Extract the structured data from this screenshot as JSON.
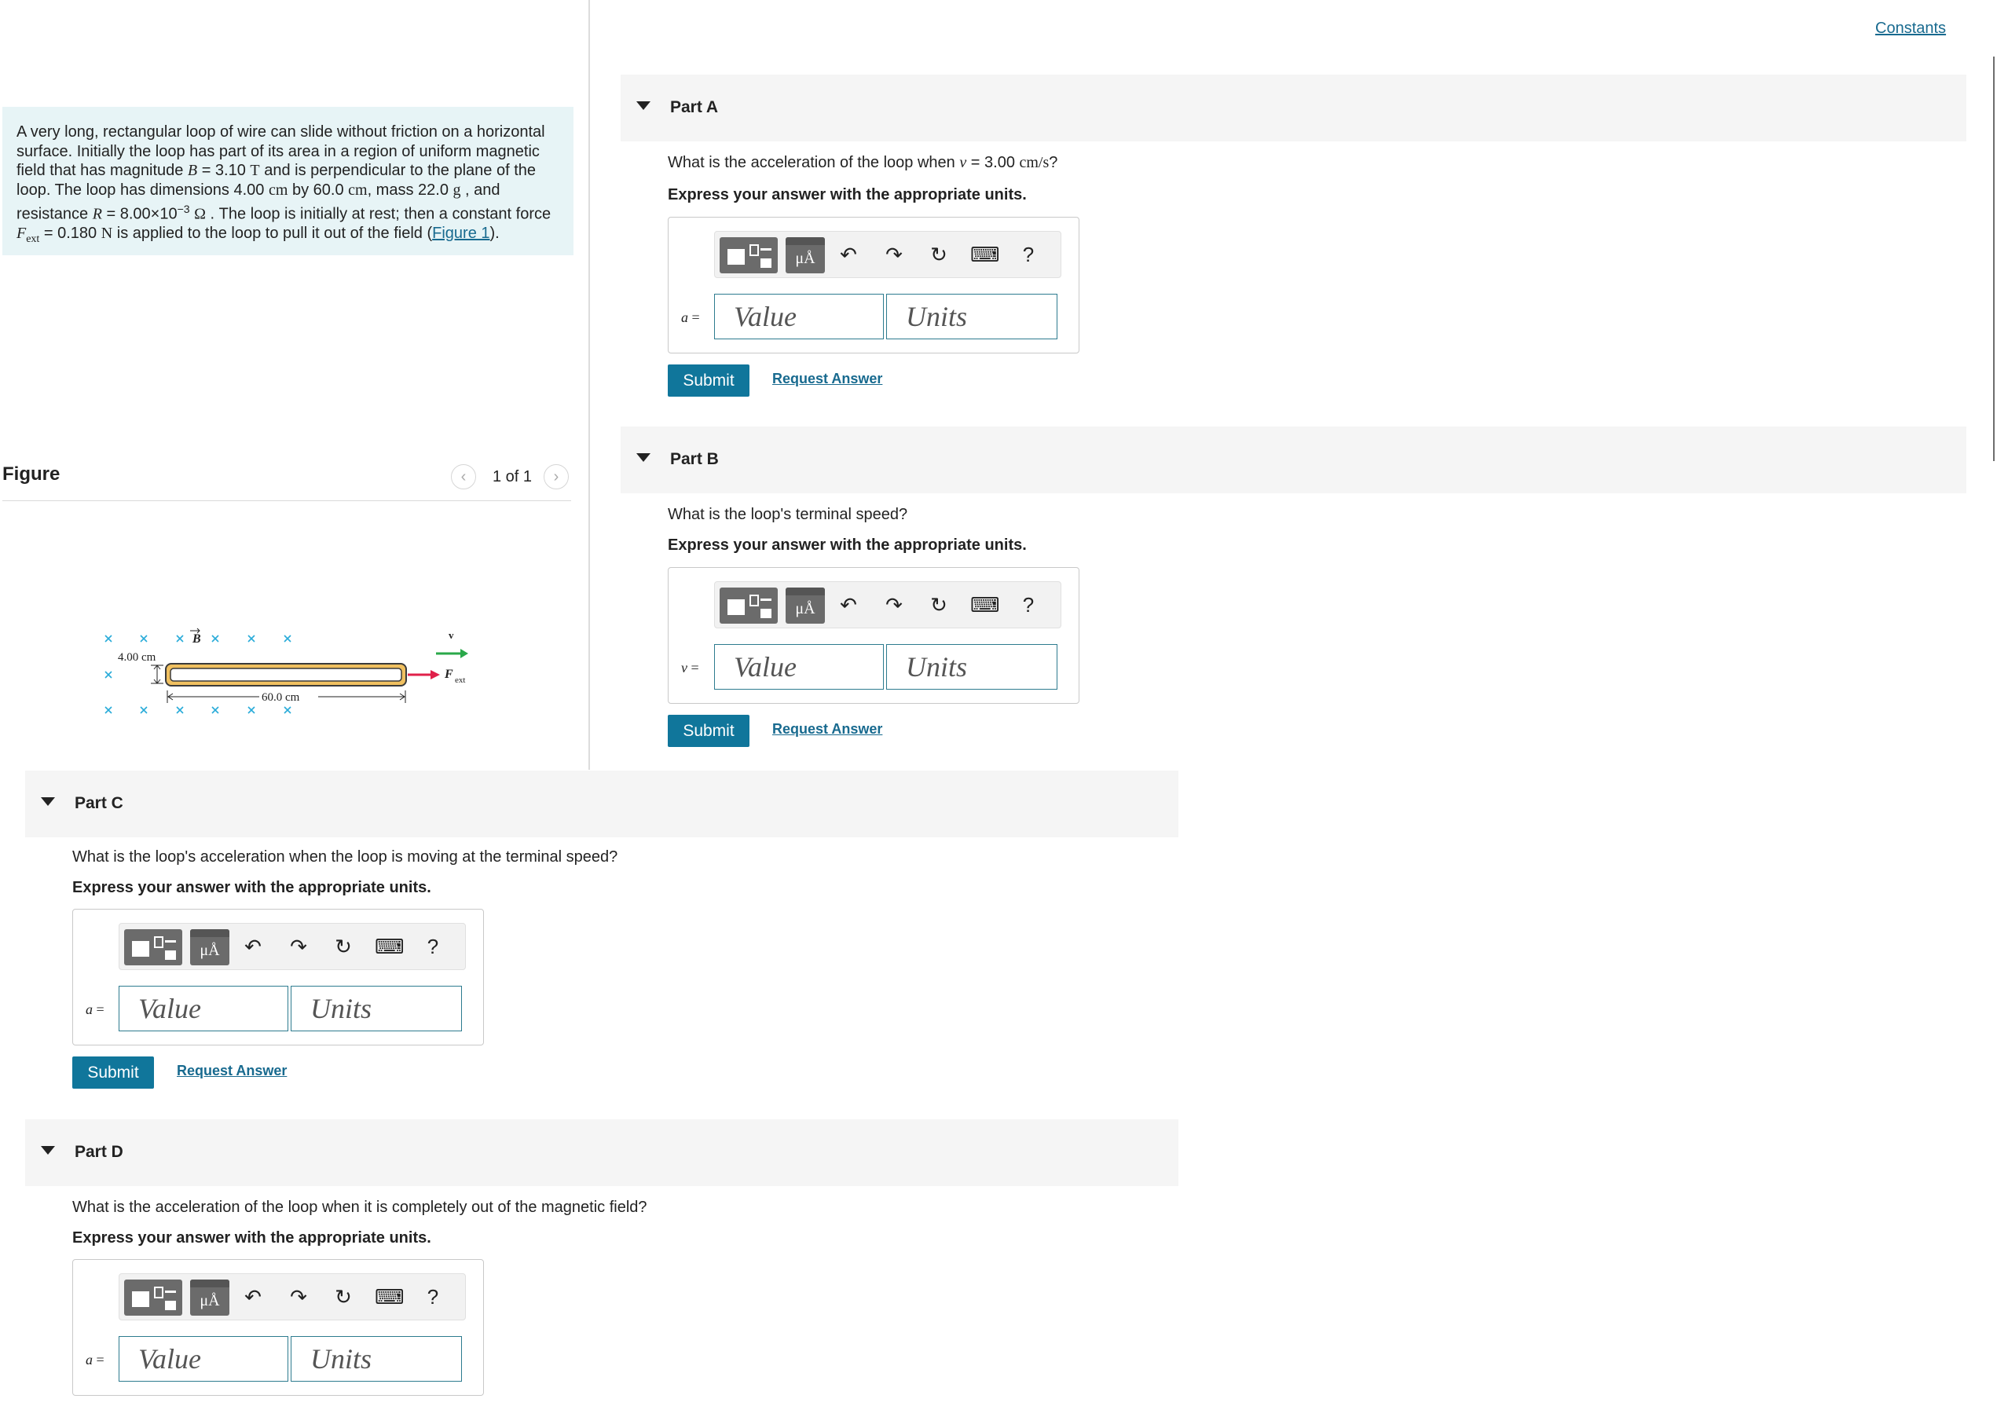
{
  "header": {
    "constants_link": "Constants"
  },
  "problem": {
    "text_1": "A very long, rectangular loop of wire can slide without friction on a horizontal surface. Initially the loop has part of its area in a region of uniform magnetic field that has magnitude ",
    "B_symbol": "B",
    "B_value": " = 3.10 ",
    "B_unit": "T",
    "text_2": " and is perpendicular to the plane of the loop. The loop has dimensions 4.00 ",
    "dim1_unit": "cm",
    "text_3": " by 60.0 ",
    "dim2_unit": "cm",
    "text_4": ", mass 22.0 ",
    "mass_unit": "g",
    "text_5": " , and resistance ",
    "R_symbol": "R",
    "R_value": " = 8.00×10",
    "R_exp": "−3",
    "R_unit": "Ω",
    "text_6": " . The loop is initially at rest; then a constant force ",
    "F_symbol": "F",
    "F_sub": "ext",
    "F_value": " = 0.180 ",
    "F_unit": "N",
    "text_7": " is applied to the loop to pull it out of the field (",
    "figure_link": "Figure 1",
    "text_8": ")."
  },
  "figure": {
    "title": "Figure",
    "counter": "1 of 1",
    "prev_icon": "chevron-left-icon",
    "next_icon": "chevron-right-icon",
    "labels": {
      "b_field": "B",
      "height": "4.00 cm",
      "length": "60.0 cm",
      "velocity": "v",
      "force": "F",
      "force_sub": "ext"
    },
    "colors": {
      "field_x": "#29abd9",
      "loop_fill": "#f0c060",
      "loop_stroke": "#3a3a3a",
      "velocity_arrow": "#2aa84a",
      "force_arrow": "#e0204a"
    }
  },
  "parts": [
    {
      "title": "Part A",
      "question_pre": "What is the acceleration of the loop when ",
      "question_var": "v",
      "question_eq": " = 3.00 ",
      "question_unit": "cm/s",
      "question_post": "?",
      "instruction": "Express your answer with the appropriate units.",
      "variable": "a",
      "equals": " =",
      "value_placeholder": "Value",
      "units_placeholder": "Units",
      "submit": "Submit",
      "request": "Request Answer"
    },
    {
      "title": "Part B",
      "question": "What is the loop's terminal speed?",
      "instruction": "Express your answer with the appropriate units.",
      "variable": "v",
      "equals": " =",
      "value_placeholder": "Value",
      "units_placeholder": "Units",
      "submit": "Submit",
      "request": "Request Answer"
    },
    {
      "title": "Part C",
      "question": "What is the loop's acceleration when the loop is moving at the terminal speed?",
      "instruction": "Express your answer with the appropriate units.",
      "variable": "a",
      "equals": " =",
      "value_placeholder": "Value",
      "units_placeholder": "Units",
      "submit": "Submit",
      "request": "Request Answer"
    },
    {
      "title": "Part D",
      "question": "What is the acceleration of the loop when it is completely out of the magnetic field?",
      "instruction": "Express your answer with the appropriate units.",
      "variable": "a",
      "equals": " =",
      "value_placeholder": "Value",
      "units_placeholder": "Units"
    }
  ],
  "toolbar": {
    "templates_icon": "templates-icon",
    "units_icon": "units-icon",
    "units_glyph": "μÅ",
    "undo_icon": "undo-icon",
    "redo_icon": "redo-icon",
    "reset_icon": "reset-icon",
    "keyboard_icon": "keyboard-icon",
    "help_label": "?"
  }
}
